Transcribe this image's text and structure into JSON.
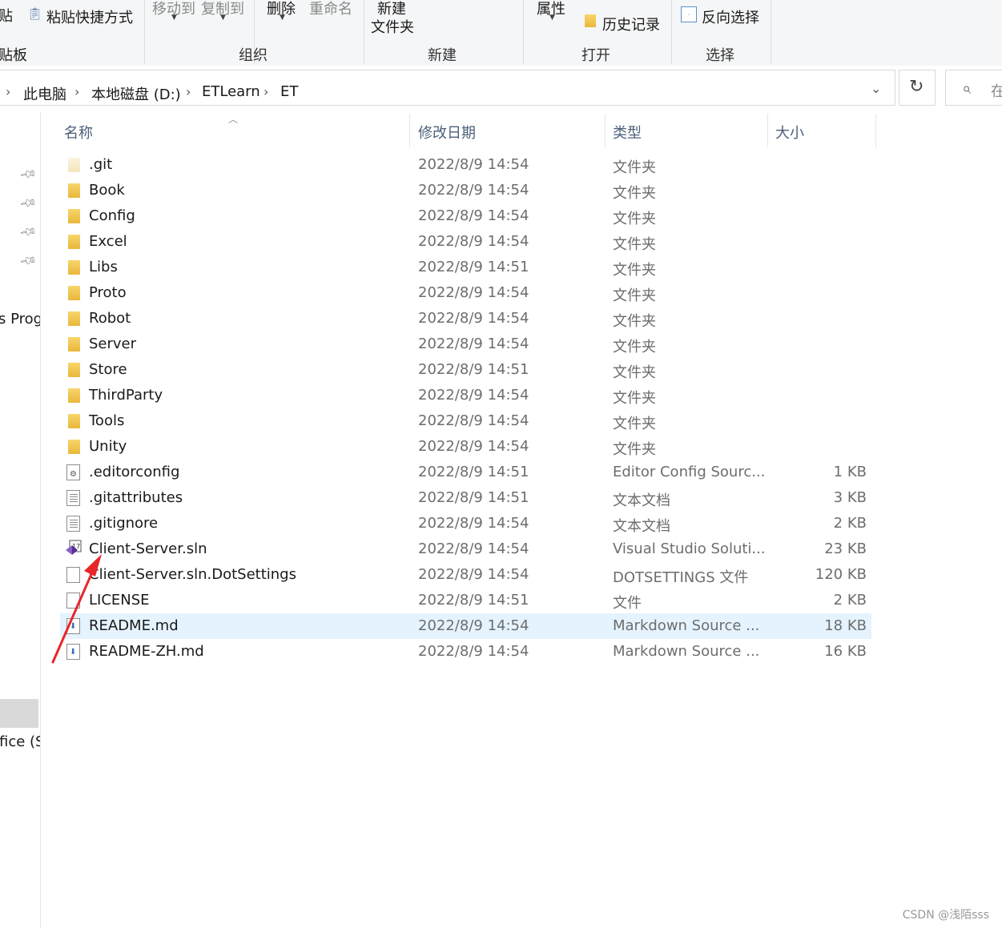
{
  "ribbon": {
    "clip_partial": "贴",
    "paste_shortcut": "粘贴快捷方式",
    "clipboard_partial": "贴板",
    "move_to": "移动到",
    "copy_to": "复制到",
    "delete": "删除",
    "rename": "重命名",
    "new_folder_line1": "新建",
    "new_folder_line2": "文件夹",
    "properties": "属性",
    "history": "历史记录",
    "invert_selection": "反向选择",
    "group_organize": "组织",
    "group_new": "新建",
    "group_open": "打开",
    "group_select": "选择"
  },
  "address": {
    "crumbs": [
      "此电脑",
      "本地磁盘 (D:)",
      "ETLearn",
      "ET"
    ],
    "search_partial": "在"
  },
  "nav": {
    "prog_partial": "s Prog",
    "office_partial": "fice (S"
  },
  "columns": {
    "name": "名称",
    "date": "修改日期",
    "type": "类型",
    "size": "大小"
  },
  "files": [
    {
      "name": ".git",
      "date": "2022/8/9 14:54",
      "type": "文件夹",
      "size": "",
      "icon": "folder-faded-icon"
    },
    {
      "name": "Book",
      "date": "2022/8/9 14:54",
      "type": "文件夹",
      "size": "",
      "icon": "folder-icon"
    },
    {
      "name": "Config",
      "date": "2022/8/9 14:54",
      "type": "文件夹",
      "size": "",
      "icon": "folder-icon"
    },
    {
      "name": "Excel",
      "date": "2022/8/9 14:54",
      "type": "文件夹",
      "size": "",
      "icon": "folder-icon"
    },
    {
      "name": "Libs",
      "date": "2022/8/9 14:51",
      "type": "文件夹",
      "size": "",
      "icon": "folder-icon"
    },
    {
      "name": "Proto",
      "date": "2022/8/9 14:54",
      "type": "文件夹",
      "size": "",
      "icon": "folder-icon"
    },
    {
      "name": "Robot",
      "date": "2022/8/9 14:54",
      "type": "文件夹",
      "size": "",
      "icon": "folder-icon"
    },
    {
      "name": "Server",
      "date": "2022/8/9 14:54",
      "type": "文件夹",
      "size": "",
      "icon": "folder-icon"
    },
    {
      "name": "Store",
      "date": "2022/8/9 14:51",
      "type": "文件夹",
      "size": "",
      "icon": "folder-icon"
    },
    {
      "name": "ThirdParty",
      "date": "2022/8/9 14:54",
      "type": "文件夹",
      "size": "",
      "icon": "folder-icon"
    },
    {
      "name": "Tools",
      "date": "2022/8/9 14:54",
      "type": "文件夹",
      "size": "",
      "icon": "folder-icon"
    },
    {
      "name": "Unity",
      "date": "2022/8/9 14:54",
      "type": "文件夹",
      "size": "",
      "icon": "folder-icon"
    },
    {
      "name": ".editorconfig",
      "date": "2022/8/9 14:51",
      "type": "Editor Config Sourc...",
      "size": "1 KB",
      "icon": "config-file-icon"
    },
    {
      "name": ".gitattributes",
      "date": "2022/8/9 14:51",
      "type": "文本文档",
      "size": "3 KB",
      "icon": "text-file-icon"
    },
    {
      "name": ".gitignore",
      "date": "2022/8/9 14:54",
      "type": "文本文档",
      "size": "2 KB",
      "icon": "text-file-icon"
    },
    {
      "name": "Client-Server.sln",
      "date": "2022/8/9 14:54",
      "type": "Visual Studio Soluti...",
      "size": "23 KB",
      "icon": "visual-studio-solution-icon"
    },
    {
      "name": "Client-Server.sln.DotSettings",
      "date": "2022/8/9 14:54",
      "type": "DOTSETTINGS 文件",
      "size": "120 KB",
      "icon": "blank-file-icon"
    },
    {
      "name": "LICENSE",
      "date": "2022/8/9 14:51",
      "type": "文件",
      "size": "2 KB",
      "icon": "blank-file-icon"
    },
    {
      "name": "README.md",
      "date": "2022/8/9 14:54",
      "type": "Markdown Source ...",
      "size": "18 KB",
      "icon": "markdown-file-icon",
      "selected": true
    },
    {
      "name": "README-ZH.md",
      "date": "2022/8/9 14:54",
      "type": "Markdown Source ...",
      "size": "16 KB",
      "icon": "markdown-file-icon"
    }
  ],
  "watermark": "CSDN @浅陌sss",
  "colors": {
    "selected_row": "#e5f3ff",
    "header_text": "#4c607a",
    "annotation_arrow": "#e8262a"
  }
}
